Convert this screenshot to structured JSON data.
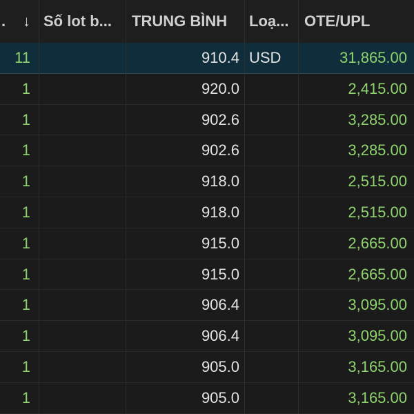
{
  "table": {
    "headers": {
      "col0": ".",
      "sort_icon": "↓",
      "lots_header": "Số lot b...",
      "avg_header": "TRUNG BÌNH",
      "type_header": "Loạ...",
      "ote_header": "OTE/UPL"
    },
    "rows": [
      {
        "lots": "11",
        "avg": "910.4",
        "type": "USD",
        "ote": "31,865.00",
        "selected": true
      },
      {
        "lots": "1",
        "avg": "920.0",
        "type": "",
        "ote": "2,415.00"
      },
      {
        "lots": "1",
        "avg": "902.6",
        "type": "",
        "ote": "3,285.00"
      },
      {
        "lots": "1",
        "avg": "902.6",
        "type": "",
        "ote": "3,285.00"
      },
      {
        "lots": "1",
        "avg": "918.0",
        "type": "",
        "ote": "2,515.00"
      },
      {
        "lots": "1",
        "avg": "918.0",
        "type": "",
        "ote": "2,515.00"
      },
      {
        "lots": "1",
        "avg": "915.0",
        "type": "",
        "ote": "2,665.00"
      },
      {
        "lots": "1",
        "avg": "915.0",
        "type": "",
        "ote": "2,665.00"
      },
      {
        "lots": "1",
        "avg": "906.4",
        "type": "",
        "ote": "3,095.00"
      },
      {
        "lots": "1",
        "avg": "906.4",
        "type": "",
        "ote": "3,095.00"
      },
      {
        "lots": "1",
        "avg": "905.0",
        "type": "",
        "ote": "3,165.00"
      },
      {
        "lots": "1",
        "avg": "905.0",
        "type": "",
        "ote": "3,165.00"
      }
    ]
  },
  "colors": {
    "background": "#1b1b1c",
    "selected_row": "#0f2d3b",
    "positive": "#8fd36e",
    "text": "#e3e3e3"
  }
}
